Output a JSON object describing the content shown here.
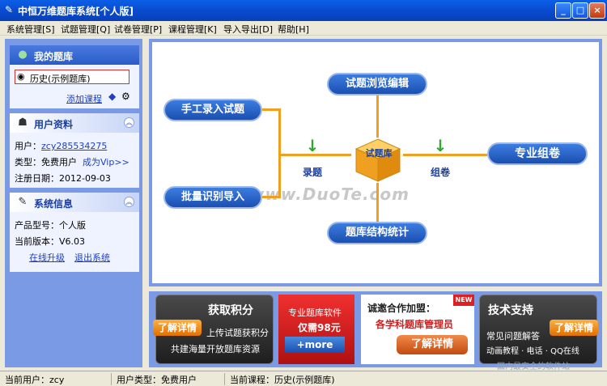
{
  "window": {
    "title": "中恒万维题库系统[个人版]"
  },
  "menu": [
    "系统管理[S]",
    "试题管理[Q]",
    "试卷管理[P]",
    "课程管理[K]",
    "导入导出[D]",
    "帮助[H]"
  ],
  "sidebar": {
    "my_library": {
      "title": "我的题库",
      "course": "历史(示例题库)",
      "add_course": "添加课程"
    },
    "user_info": {
      "title": "用户资料",
      "user_label": "用户：",
      "user_value": "zcy285534275",
      "type_label": "类型：",
      "type_value": "免费用户",
      "vip_link": "成为Vip>>",
      "date_label": "注册日期：",
      "date_value": "2012-09-03"
    },
    "system_info": {
      "title": "系统信息",
      "product_label": "产品型号：",
      "product_value": "个人版",
      "version_label": "当前版本：",
      "version_value": "V6.03",
      "upgrade_link": "在线升级",
      "exit_link": "退出系统"
    }
  },
  "diagram": {
    "manual_entry": "手工录入试题",
    "batch_import": "批量识别导入",
    "browse_edit": "试题浏览编辑",
    "structure_stats": "题库结构统计",
    "entry_label": "录题",
    "library_label": "试题库",
    "compose_label": "组卷",
    "pro_compose": "专业组卷",
    "watermark": "www.DuoTe.com"
  },
  "banner": {
    "points": {
      "title": "获取积分",
      "badge": "了解详情",
      "line1": "上传试题获积分",
      "line2": "共建海量开放题库资源"
    },
    "software": {
      "line1": "专业题库软件",
      "line2": "仅需98元",
      "more": "+more"
    },
    "partner": {
      "title": "诚邀合作加盟：",
      "subtitle": "各学科题库管理员",
      "button": "了解详情",
      "tag": "NEW"
    },
    "support": {
      "title": "技术支持",
      "badge": "了解详情",
      "line1": "常见问题解答",
      "line2": "动画教程 · 电话 · QQ在线"
    }
  },
  "status": {
    "user_label": "当前用户：",
    "user_value": "zcy",
    "type_label": "用户类型：",
    "type_value": "免费用户",
    "course_label": "当前课程：",
    "course_value": "历史(示例题库)"
  },
  "site_watermark": "国内最安全的软件站"
}
